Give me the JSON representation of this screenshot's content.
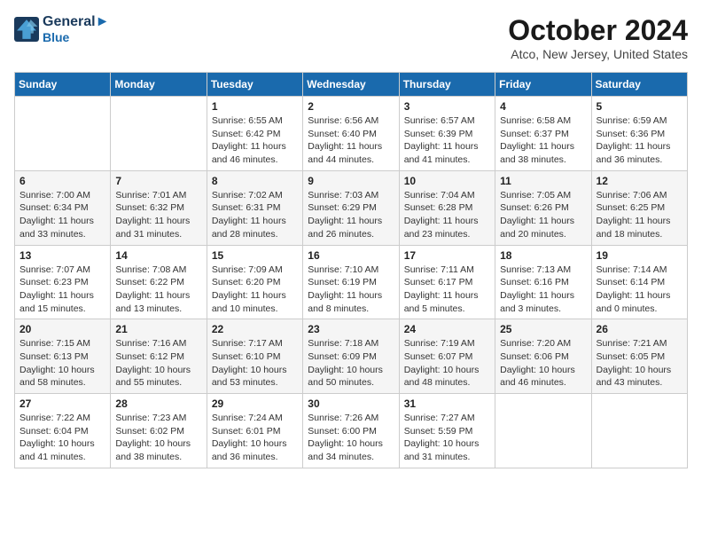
{
  "header": {
    "logo_line1": "General",
    "logo_line2": "Blue",
    "title": "October 2024",
    "subtitle": "Atco, New Jersey, United States"
  },
  "days_of_week": [
    "Sunday",
    "Monday",
    "Tuesday",
    "Wednesday",
    "Thursday",
    "Friday",
    "Saturday"
  ],
  "weeks": [
    [
      {
        "day": "",
        "sunrise": "",
        "sunset": "",
        "daylight": ""
      },
      {
        "day": "",
        "sunrise": "",
        "sunset": "",
        "daylight": ""
      },
      {
        "day": "1",
        "sunrise": "Sunrise: 6:55 AM",
        "sunset": "Sunset: 6:42 PM",
        "daylight": "Daylight: 11 hours and 46 minutes."
      },
      {
        "day": "2",
        "sunrise": "Sunrise: 6:56 AM",
        "sunset": "Sunset: 6:40 PM",
        "daylight": "Daylight: 11 hours and 44 minutes."
      },
      {
        "day": "3",
        "sunrise": "Sunrise: 6:57 AM",
        "sunset": "Sunset: 6:39 PM",
        "daylight": "Daylight: 11 hours and 41 minutes."
      },
      {
        "day": "4",
        "sunrise": "Sunrise: 6:58 AM",
        "sunset": "Sunset: 6:37 PM",
        "daylight": "Daylight: 11 hours and 38 minutes."
      },
      {
        "day": "5",
        "sunrise": "Sunrise: 6:59 AM",
        "sunset": "Sunset: 6:36 PM",
        "daylight": "Daylight: 11 hours and 36 minutes."
      }
    ],
    [
      {
        "day": "6",
        "sunrise": "Sunrise: 7:00 AM",
        "sunset": "Sunset: 6:34 PM",
        "daylight": "Daylight: 11 hours and 33 minutes."
      },
      {
        "day": "7",
        "sunrise": "Sunrise: 7:01 AM",
        "sunset": "Sunset: 6:32 PM",
        "daylight": "Daylight: 11 hours and 31 minutes."
      },
      {
        "day": "8",
        "sunrise": "Sunrise: 7:02 AM",
        "sunset": "Sunset: 6:31 PM",
        "daylight": "Daylight: 11 hours and 28 minutes."
      },
      {
        "day": "9",
        "sunrise": "Sunrise: 7:03 AM",
        "sunset": "Sunset: 6:29 PM",
        "daylight": "Daylight: 11 hours and 26 minutes."
      },
      {
        "day": "10",
        "sunrise": "Sunrise: 7:04 AM",
        "sunset": "Sunset: 6:28 PM",
        "daylight": "Daylight: 11 hours and 23 minutes."
      },
      {
        "day": "11",
        "sunrise": "Sunrise: 7:05 AM",
        "sunset": "Sunset: 6:26 PM",
        "daylight": "Daylight: 11 hours and 20 minutes."
      },
      {
        "day": "12",
        "sunrise": "Sunrise: 7:06 AM",
        "sunset": "Sunset: 6:25 PM",
        "daylight": "Daylight: 11 hours and 18 minutes."
      }
    ],
    [
      {
        "day": "13",
        "sunrise": "Sunrise: 7:07 AM",
        "sunset": "Sunset: 6:23 PM",
        "daylight": "Daylight: 11 hours and 15 minutes."
      },
      {
        "day": "14",
        "sunrise": "Sunrise: 7:08 AM",
        "sunset": "Sunset: 6:22 PM",
        "daylight": "Daylight: 11 hours and 13 minutes."
      },
      {
        "day": "15",
        "sunrise": "Sunrise: 7:09 AM",
        "sunset": "Sunset: 6:20 PM",
        "daylight": "Daylight: 11 hours and 10 minutes."
      },
      {
        "day": "16",
        "sunrise": "Sunrise: 7:10 AM",
        "sunset": "Sunset: 6:19 PM",
        "daylight": "Daylight: 11 hours and 8 minutes."
      },
      {
        "day": "17",
        "sunrise": "Sunrise: 7:11 AM",
        "sunset": "Sunset: 6:17 PM",
        "daylight": "Daylight: 11 hours and 5 minutes."
      },
      {
        "day": "18",
        "sunrise": "Sunrise: 7:13 AM",
        "sunset": "Sunset: 6:16 PM",
        "daylight": "Daylight: 11 hours and 3 minutes."
      },
      {
        "day": "19",
        "sunrise": "Sunrise: 7:14 AM",
        "sunset": "Sunset: 6:14 PM",
        "daylight": "Daylight: 11 hours and 0 minutes."
      }
    ],
    [
      {
        "day": "20",
        "sunrise": "Sunrise: 7:15 AM",
        "sunset": "Sunset: 6:13 PM",
        "daylight": "Daylight: 10 hours and 58 minutes."
      },
      {
        "day": "21",
        "sunrise": "Sunrise: 7:16 AM",
        "sunset": "Sunset: 6:12 PM",
        "daylight": "Daylight: 10 hours and 55 minutes."
      },
      {
        "day": "22",
        "sunrise": "Sunrise: 7:17 AM",
        "sunset": "Sunset: 6:10 PM",
        "daylight": "Daylight: 10 hours and 53 minutes."
      },
      {
        "day": "23",
        "sunrise": "Sunrise: 7:18 AM",
        "sunset": "Sunset: 6:09 PM",
        "daylight": "Daylight: 10 hours and 50 minutes."
      },
      {
        "day": "24",
        "sunrise": "Sunrise: 7:19 AM",
        "sunset": "Sunset: 6:07 PM",
        "daylight": "Daylight: 10 hours and 48 minutes."
      },
      {
        "day": "25",
        "sunrise": "Sunrise: 7:20 AM",
        "sunset": "Sunset: 6:06 PM",
        "daylight": "Daylight: 10 hours and 46 minutes."
      },
      {
        "day": "26",
        "sunrise": "Sunrise: 7:21 AM",
        "sunset": "Sunset: 6:05 PM",
        "daylight": "Daylight: 10 hours and 43 minutes."
      }
    ],
    [
      {
        "day": "27",
        "sunrise": "Sunrise: 7:22 AM",
        "sunset": "Sunset: 6:04 PM",
        "daylight": "Daylight: 10 hours and 41 minutes."
      },
      {
        "day": "28",
        "sunrise": "Sunrise: 7:23 AM",
        "sunset": "Sunset: 6:02 PM",
        "daylight": "Daylight: 10 hours and 38 minutes."
      },
      {
        "day": "29",
        "sunrise": "Sunrise: 7:24 AM",
        "sunset": "Sunset: 6:01 PM",
        "daylight": "Daylight: 10 hours and 36 minutes."
      },
      {
        "day": "30",
        "sunrise": "Sunrise: 7:26 AM",
        "sunset": "Sunset: 6:00 PM",
        "daylight": "Daylight: 10 hours and 34 minutes."
      },
      {
        "day": "31",
        "sunrise": "Sunrise: 7:27 AM",
        "sunset": "Sunset: 5:59 PM",
        "daylight": "Daylight: 10 hours and 31 minutes."
      },
      {
        "day": "",
        "sunrise": "",
        "sunset": "",
        "daylight": ""
      },
      {
        "day": "",
        "sunrise": "",
        "sunset": "",
        "daylight": ""
      }
    ]
  ]
}
